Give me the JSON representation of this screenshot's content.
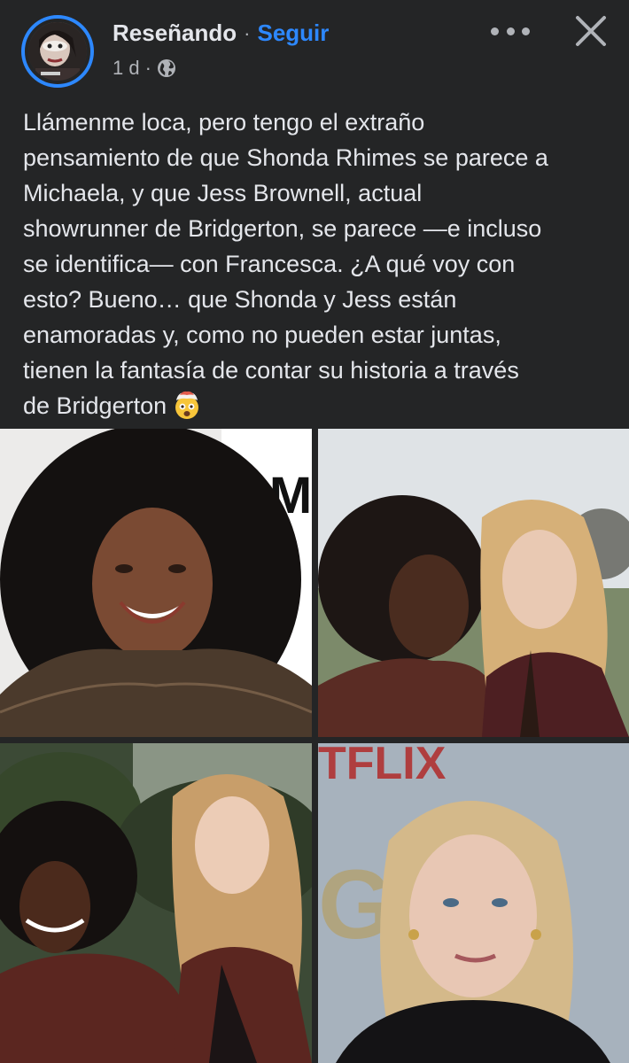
{
  "header": {
    "author": "Reseñando",
    "separator": "·",
    "follow_label": "Seguir",
    "timestamp": "1 d",
    "meta_separator": "·",
    "privacy_icon": "globe-icon",
    "more_icon": "more-options-icon",
    "close_icon": "close-icon"
  },
  "post": {
    "lines": [
      "Llámenme loca, pero tengo el extraño",
      "pensamiento de que Shonda Rhimes se parece a",
      "Michaela, y que Jess Brownell, actual",
      "showrunner de Bridgerton, se parece —e incluso",
      "se identifica— con Francesca. ¿A qué voy con",
      "esto? Bueno… que Shonda y Jess están",
      "enamoradas y, como no pueden estar juntas,",
      "tienen la fantasía de contar su historia a través",
      "de Bridgerton"
    ],
    "end_emoji": "exploding-head-emoji"
  },
  "photos": {
    "photo1_backdrop_text": "AM",
    "photo4_backdrop_text": "TFLIX",
    "photo4_backdrop_text2": "GE T"
  },
  "colors": {
    "background": "#242526",
    "text": "#e4e6eb",
    "secondary": "#b0b3b8",
    "accent": "#2d88ff"
  }
}
